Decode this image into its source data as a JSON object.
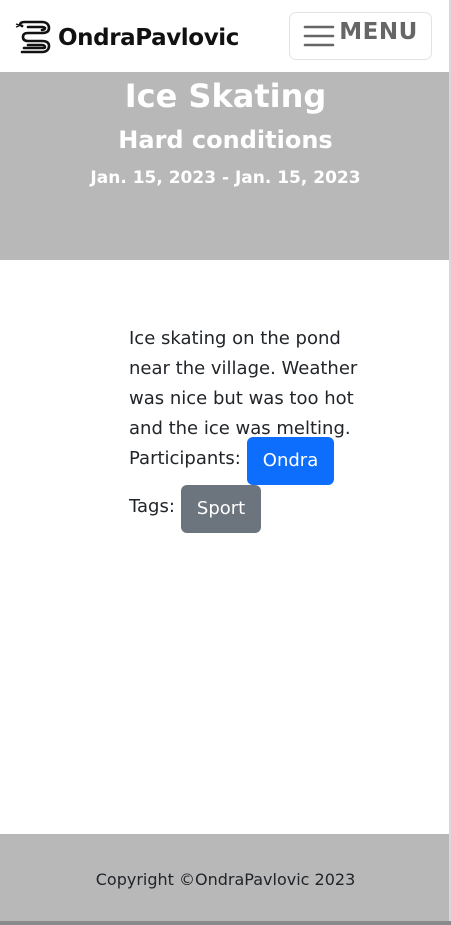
{
  "navbar": {
    "brand_name": "OndraPavlovic",
    "brand_icon": "snake-logo-icon",
    "menu_label": "MENU",
    "menu_icon": "hamburger-icon"
  },
  "event": {
    "title": "Ice Skating",
    "subtitle": "Hard conditions",
    "dates": "Jan. 15, 2023 - Jan. 15, 2023",
    "description": "Ice skating on the pond near the village. Weather was nice but was too hot and the ice was melting.",
    "participants_label": "Participants:",
    "participants": [
      "Ondra"
    ],
    "tags_label": "Tags:",
    "tags": [
      "Sport"
    ]
  },
  "footer": {
    "copyright": "Copyright ©OndraPavlovic 2023"
  },
  "colors": {
    "header_bg": "#b8b8b8",
    "footer_bg": "#b8b8b8",
    "participant_badge": "#0d6efd",
    "tag_badge": "#6c757d"
  }
}
